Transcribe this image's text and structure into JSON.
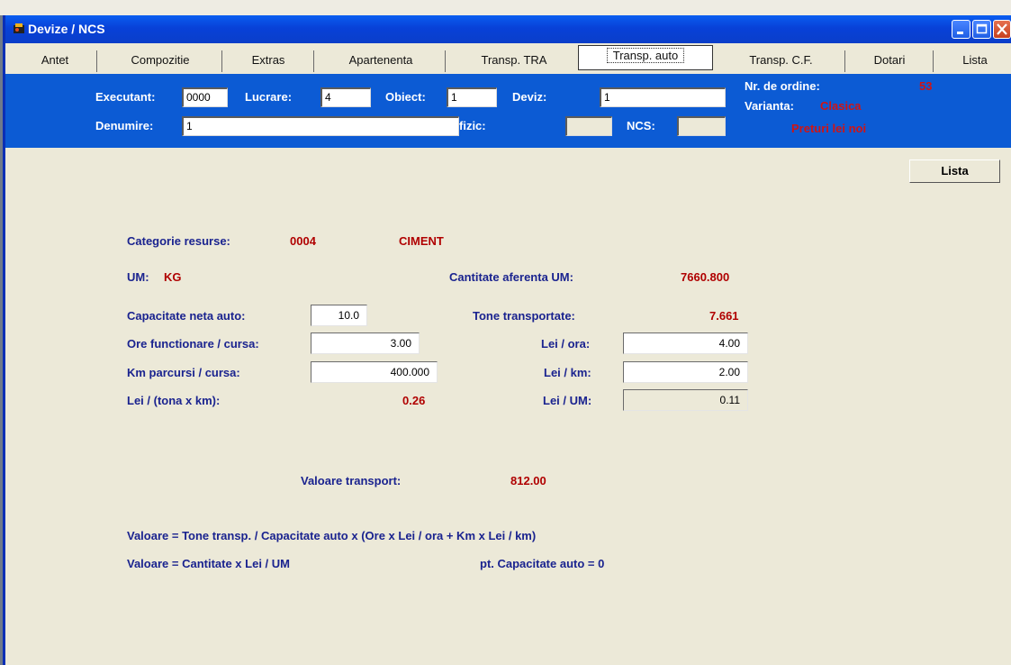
{
  "window": {
    "title": "Devize / NCS"
  },
  "tabs": [
    {
      "label": "Antet"
    },
    {
      "label": "Compozitie"
    },
    {
      "label": "Extras"
    },
    {
      "label": "Apartenenta"
    },
    {
      "label": "Transp. TRA"
    },
    {
      "label": "Transp. auto"
    },
    {
      "label": "Transp. C.F."
    },
    {
      "label": "Dotari"
    },
    {
      "label": "Lista"
    }
  ],
  "header": {
    "executant_label": "Executant:",
    "executant_value": "0000",
    "lucrare_label": "Lucrare:",
    "lucrare_value": "4",
    "obiect_label": "Obiect:",
    "obiect_value": "1",
    "deviz_label": "Deviz:",
    "deviz_value": "1",
    "denumire_label": "Denumire:",
    "denumire_value": "1",
    "fizic_label": "fizic:",
    "fizic_value": "",
    "ncs_label": "NCS:",
    "ncs_value": "",
    "nr_ordine_label": "Nr. de ordine:",
    "nr_ordine_value": "53",
    "varianta_label": "Varianta:",
    "varianta_value": "Clasica",
    "preturi_text": "Preturi lei noi"
  },
  "buttons": {
    "lista": "Lista"
  },
  "main": {
    "categorie_label": "Categorie resurse:",
    "categorie_code": "0004",
    "categorie_name": "CIMENT",
    "um_label": "UM:",
    "um_value": "KG",
    "cantitate_label": "Cantitate aferenta UM:",
    "cantitate_value": "7660.800",
    "capacitate_label": "Capacitate neta auto:",
    "capacitate_value": "10.0",
    "tone_label": "Tone transportate:",
    "tone_value": "7.661",
    "ore_label": "Ore functionare / cursa:",
    "ore_value": "3.00",
    "lei_ora_label": "Lei / ora:",
    "lei_ora_value": "4.00",
    "km_label": "Km parcursi / cursa:",
    "km_value": "400.000",
    "lei_km_label": "Lei / km:",
    "lei_km_value": "2.00",
    "lei_tona_km_label": "Lei / (tona x km):",
    "lei_tona_km_value": "0.26",
    "lei_um_label": "Lei / UM:",
    "lei_um_value": "0.11",
    "valoare_transport_label": "Valoare transport:",
    "valoare_transport_value": "812.00",
    "formula1": "Valoare = Tone transp. / Capacitate auto x (Ore x Lei / ora + Km x Lei / km)",
    "formula2": "Valoare = Cantitate x Lei / UM",
    "formula2_note": "pt. Capacitate auto = 0"
  },
  "colors": {
    "header_bg": "#0c5bd4",
    "label_blue": "#1a238f",
    "value_red": "#b00000",
    "panel_bg": "#ece9d8"
  }
}
